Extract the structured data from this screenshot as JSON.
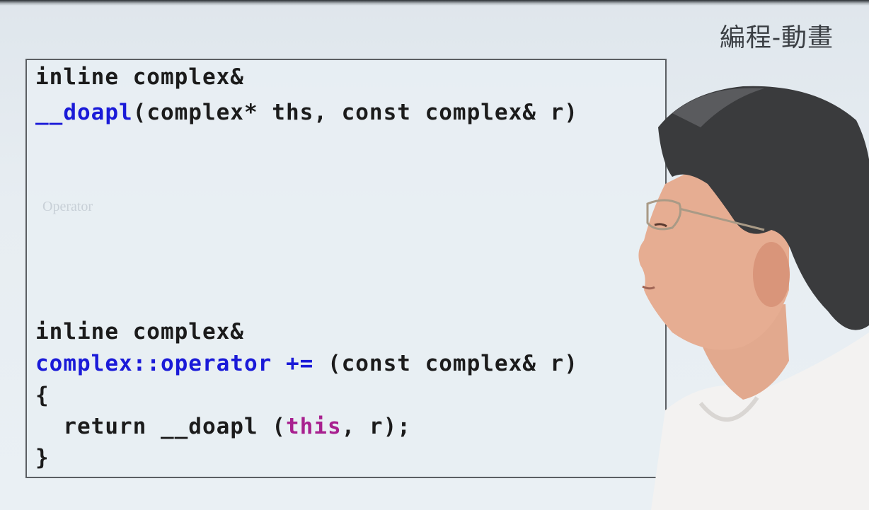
{
  "watermark": "編程-動畫",
  "code": {
    "l1": "inline complex&",
    "l2_fn": "__doapl",
    "l2_rest": "(complex* ths, const complex& r)",
    "ghost": "Operator",
    "l3": "inline complex&",
    "l4_fn": "complex::operator +=",
    "l4_rest": " (const complex& r)",
    "l5": "{",
    "l6_a": "  return __doapl (",
    "l6_kw": "this",
    "l6_b": ", r);",
    "l7": "}"
  },
  "colors": {
    "keyword_blue": "#1a1ad8",
    "keyword_purple": "#a8208f"
  }
}
